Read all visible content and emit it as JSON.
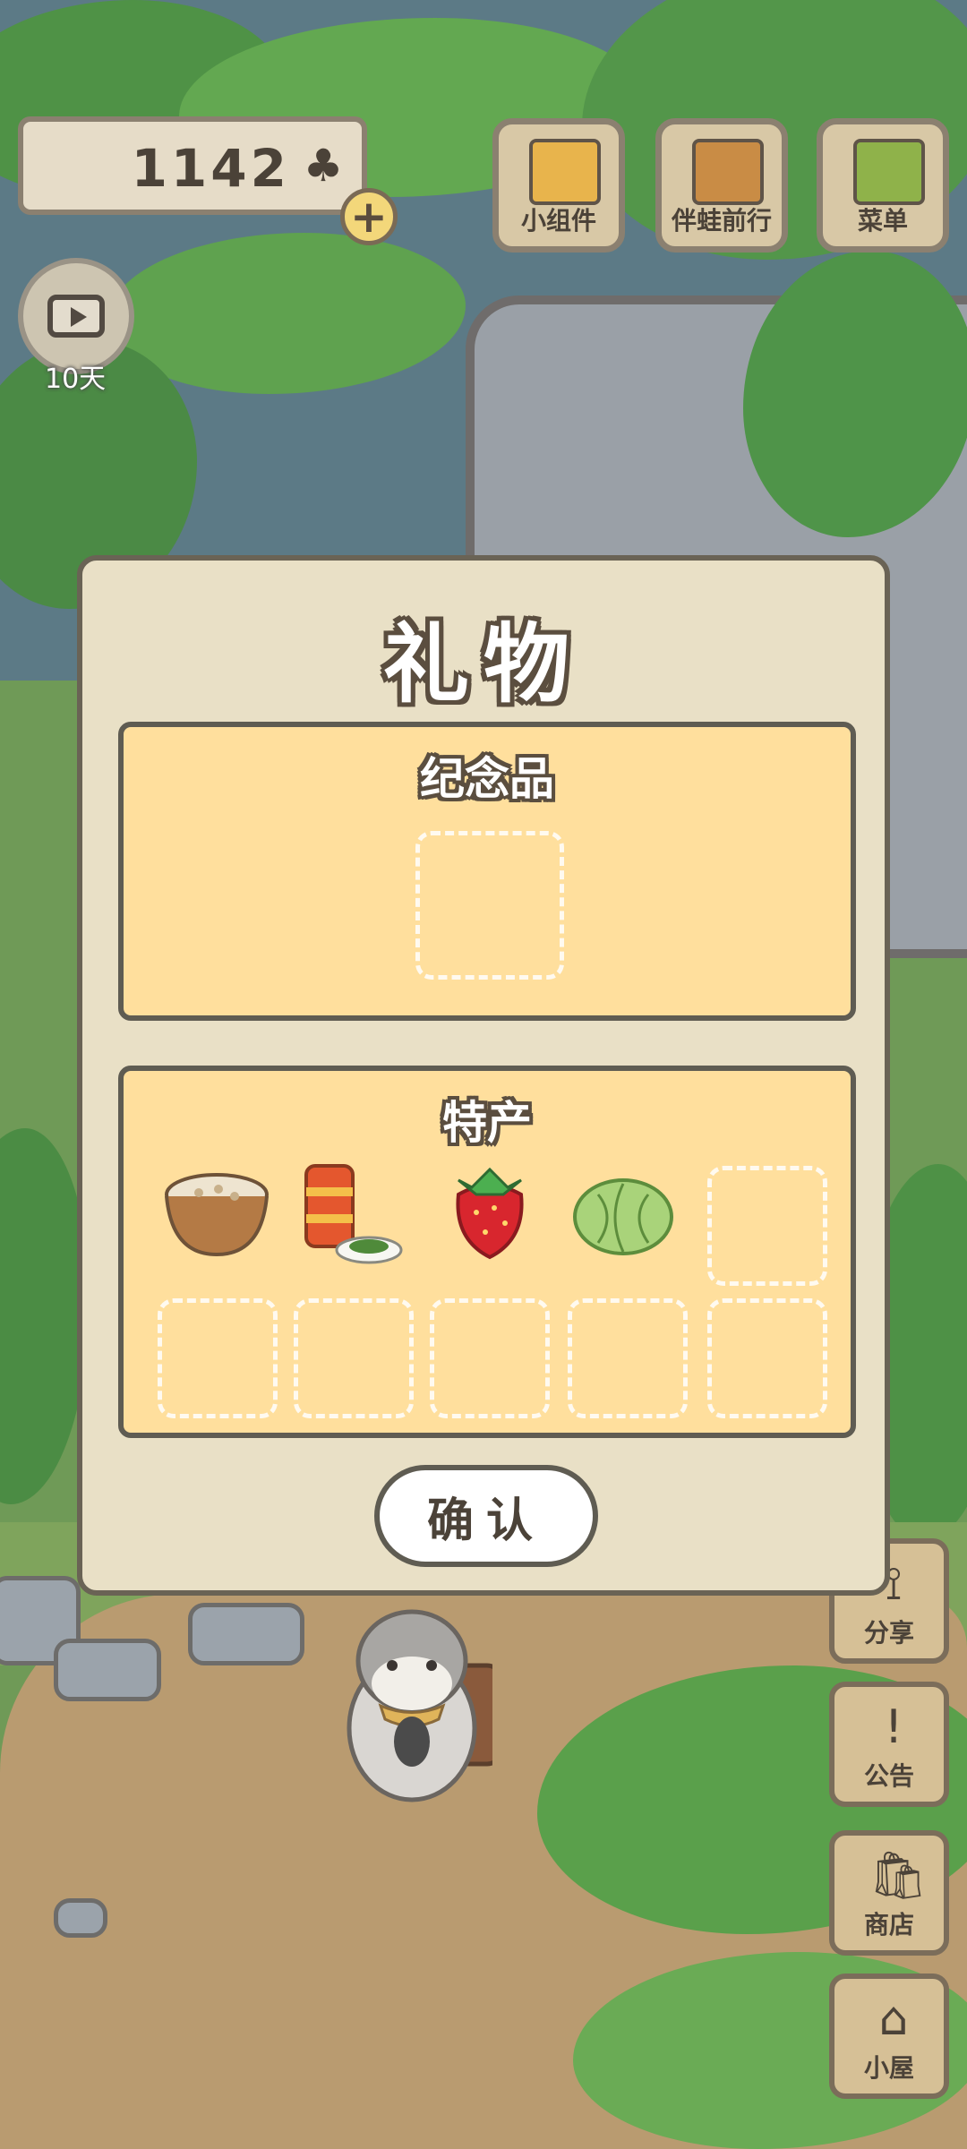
{
  "currency": {
    "value": "1142",
    "icon": "clover-icon",
    "add_label": "+"
  },
  "tv": {
    "days_label": "10天"
  },
  "top_buttons": [
    {
      "label": "小组件",
      "icon": "widget-icon"
    },
    {
      "label": "伴蛙前行",
      "icon": "travel-book-icon"
    },
    {
      "label": "菜单",
      "icon": "menu-icon"
    }
  ],
  "side_buttons": [
    {
      "label": "分享",
      "icon": "share-icon",
      "glyph": "⟟"
    },
    {
      "label": "公告",
      "icon": "notice-icon",
      "glyph": "!"
    },
    {
      "label": "商店",
      "icon": "shop-icon",
      "glyph": "🛍"
    },
    {
      "label": "小屋",
      "icon": "house-icon",
      "glyph": "⌂"
    }
  ],
  "modal": {
    "title": "礼物",
    "souvenir_title": "纪念品",
    "specialty_title": "特产",
    "specialty_items": [
      "rice-bowl-icon",
      "tea-can-icon",
      "strawberry-icon",
      "cabbage-icon"
    ],
    "confirm_label": "确认"
  },
  "colors": {
    "panel": "#ffdf9d",
    "modal_bg": "#e9e0c6",
    "outline": "#5f5c52"
  }
}
